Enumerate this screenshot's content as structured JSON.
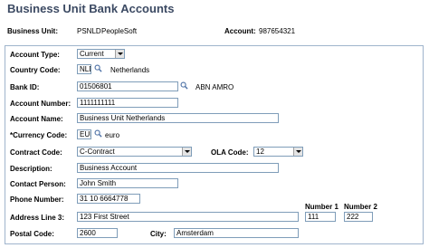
{
  "page": {
    "title": "Business Unit Bank Accounts"
  },
  "header": {
    "business_unit_label": "Business Unit:",
    "business_unit_code": "PSNLD",
    "business_unit_name": "PeopleSoft",
    "account_label": "Account:",
    "account_value": "987654321"
  },
  "form": {
    "account_type": {
      "label": "Account Type:",
      "value": "Current"
    },
    "country_code": {
      "label": "Country Code:",
      "value": "NLD",
      "desc": "Netherlands"
    },
    "bank_id": {
      "label": "Bank ID:",
      "value": "01506801",
      "desc": "ABN AMRO"
    },
    "account_number": {
      "label": "Account Number:",
      "value": "1111111111"
    },
    "account_name": {
      "label": "Account Name:",
      "value": "Business Unit Netherlands"
    },
    "currency_code": {
      "label": "*Currency Code:",
      "value": "EUR",
      "desc": "euro"
    },
    "contract_code": {
      "label": "Contract Code:",
      "value": "C-Contract"
    },
    "ola_code": {
      "label": "OLA Code:",
      "value": "12"
    },
    "description": {
      "label": "Description:",
      "value": "Business Account"
    },
    "contact_person": {
      "label": "Contact Person:",
      "value": "John Smith"
    },
    "phone_number": {
      "label": "Phone Number:",
      "value": "31 10 6664778"
    },
    "address_line_3": {
      "label": "Address Line 3:",
      "value": "123 First Street"
    },
    "number_1": {
      "label": "Number 1",
      "value": "111"
    },
    "number_2": {
      "label": "Number 2",
      "value": "222"
    },
    "postal_code": {
      "label": "Postal Code:",
      "value": "2600"
    },
    "city": {
      "label": "City:",
      "value": "Amsterdam"
    }
  },
  "icons": {
    "lookup": "magnifier-icon",
    "dropdown": "chevron-down-icon"
  },
  "colors": {
    "title": "#3c4a63",
    "frame_border": "#9fb4cc",
    "input_border": "#7f9db9",
    "lookup_icon": "#4a6fa5"
  }
}
